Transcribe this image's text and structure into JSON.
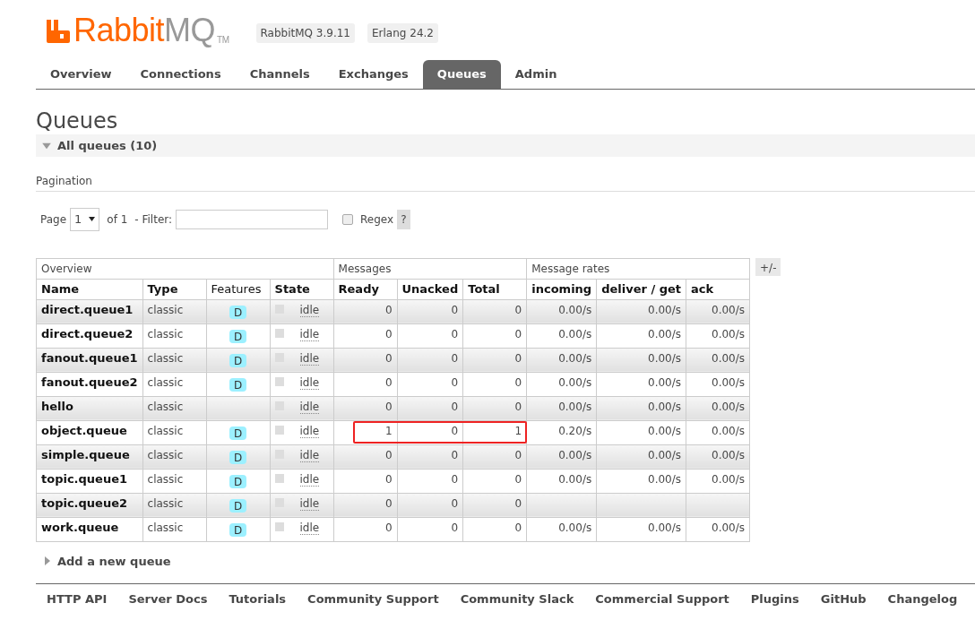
{
  "header": {
    "logo": {
      "part_1": "Rabbit",
      "part_2": "MQ",
      "mark": "TM"
    },
    "versions": [
      "RabbitMQ 3.9.11",
      "Erlang 24.2"
    ]
  },
  "tabs": [
    {
      "label": "Overview",
      "selected": false
    },
    {
      "label": "Connections",
      "selected": false
    },
    {
      "label": "Channels",
      "selected": false
    },
    {
      "label": "Exchanges",
      "selected": false
    },
    {
      "label": "Queues",
      "selected": true
    },
    {
      "label": "Admin",
      "selected": false
    }
  ],
  "page_title": "Queues",
  "section": {
    "title": "All queues (10)",
    "expanded": true
  },
  "pagination": {
    "label": "Pagination",
    "page_label": "Page",
    "page": "1",
    "of": "of 1",
    "filter_label": "- Filter:",
    "regex_label": "Regex",
    "regex_checked": false,
    "help": "?"
  },
  "table": {
    "groups": [
      {
        "label": "Overview"
      },
      {
        "label": "Messages"
      },
      {
        "label": "Message rates"
      }
    ],
    "columns_button": "+/-",
    "columns": [
      "Name",
      "Type",
      "Features",
      "State",
      "Ready",
      "Unacked",
      "Total",
      "incoming",
      "deliver / get",
      "ack"
    ],
    "rows": [
      {
        "name": "direct.queue1",
        "type": "classic",
        "feature": "D",
        "state": "idle",
        "ready": "0",
        "unacked": "0",
        "total": "0",
        "rates": [
          "0.00/s",
          "0.00/s",
          "0.00/s"
        ],
        "highlighted": false
      },
      {
        "name": "direct.queue2",
        "type": "classic",
        "feature": "D",
        "state": "idle",
        "ready": "0",
        "unacked": "0",
        "total": "0",
        "rates": [
          "0.00/s",
          "0.00/s",
          "0.00/s"
        ],
        "highlighted": false
      },
      {
        "name": "fanout.queue1",
        "type": "classic",
        "feature": "D",
        "state": "idle",
        "ready": "0",
        "unacked": "0",
        "total": "0",
        "rates": [
          "0.00/s",
          "0.00/s",
          "0.00/s"
        ],
        "highlighted": false
      },
      {
        "name": "fanout.queue2",
        "type": "classic",
        "feature": "D",
        "state": "idle",
        "ready": "0",
        "unacked": "0",
        "total": "0",
        "rates": [
          "0.00/s",
          "0.00/s",
          "0.00/s"
        ],
        "highlighted": false
      },
      {
        "name": "hello",
        "type": "classic",
        "state": "idle",
        "ready": "0",
        "unacked": "0",
        "total": "0",
        "rates": [
          "0.00/s",
          "0.00/s",
          "0.00/s"
        ],
        "highlighted": false
      },
      {
        "name": "object.queue",
        "type": "classic",
        "feature": "D",
        "state": "idle",
        "ready": "1",
        "unacked": "0",
        "total": "1",
        "rates": [
          "0.20/s",
          "0.00/s",
          "0.00/s"
        ],
        "highlighted": true
      },
      {
        "name": "simple.queue",
        "type": "classic",
        "feature": "D",
        "state": "idle",
        "ready": "0",
        "unacked": "0",
        "total": "0",
        "rates": [
          "0.00/s",
          "0.00/s",
          "0.00/s"
        ],
        "highlighted": false
      },
      {
        "name": "topic.queue1",
        "type": "classic",
        "feature": "D",
        "state": "idle",
        "ready": "0",
        "unacked": "0",
        "total": "0",
        "rates": [
          "0.00/s",
          "0.00/s",
          "0.00/s"
        ],
        "highlighted": false
      },
      {
        "name": "topic.queue2",
        "type": "classic",
        "feature": "D",
        "state": "idle",
        "ready": "0",
        "unacked": "0",
        "total": "0",
        "highlighted": false
      },
      {
        "name": "work.queue",
        "type": "classic",
        "feature": "D",
        "state": "idle",
        "ready": "0",
        "unacked": "0",
        "total": "0",
        "rates": [
          "0.00/s",
          "0.00/s",
          "0.00/s"
        ],
        "highlighted": false
      }
    ]
  },
  "add_section": {
    "title": "Add a new queue",
    "expanded": false
  },
  "footer_links": [
    "HTTP API",
    "Server Docs",
    "Tutorials",
    "Community Support",
    "Community Slack",
    "Commercial Support",
    "Plugins",
    "GitHub",
    "Changelog"
  ]
}
